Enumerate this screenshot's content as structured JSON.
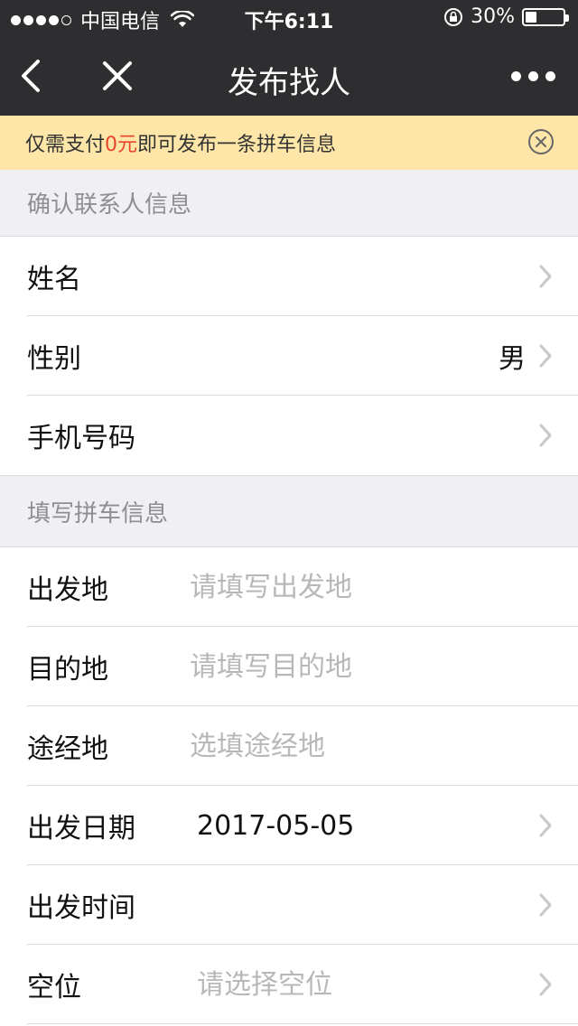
{
  "status_bar": {
    "carrier": "中国电信",
    "time": "下午6:11",
    "battery": "30%",
    "battery_level": 0.3
  },
  "nav": {
    "title": "发布找人"
  },
  "notice": {
    "prefix": "仅需支付",
    "amount": "0元",
    "suffix": "即可发布一条拼车信息"
  },
  "contact_section": {
    "header": "确认联系人信息",
    "rows": [
      {
        "label": "姓名",
        "value": ""
      },
      {
        "label": "性别",
        "value": "男"
      },
      {
        "label": "手机号码",
        "value": ""
      }
    ]
  },
  "trip_section": {
    "header": "填写拼车信息",
    "departure": {
      "label": "出发地",
      "placeholder": "请填写出发地"
    },
    "destination": {
      "label": "目的地",
      "placeholder": "请填写目的地"
    },
    "via": {
      "label": "途经地",
      "placeholder": "选填途经地"
    },
    "date": {
      "label": "出发日期",
      "value": "2017-05-05"
    },
    "time": {
      "label": "出发时间",
      "value": ""
    },
    "seats": {
      "label": "空位",
      "placeholder": "请选择空位"
    }
  },
  "colors": {
    "nav_bg": "#2e2e30",
    "notice_bg": "#fde6a8",
    "notice_highlight": "#e8442c",
    "section_bg": "#efeff4",
    "placeholder": "#b8b8b8"
  }
}
